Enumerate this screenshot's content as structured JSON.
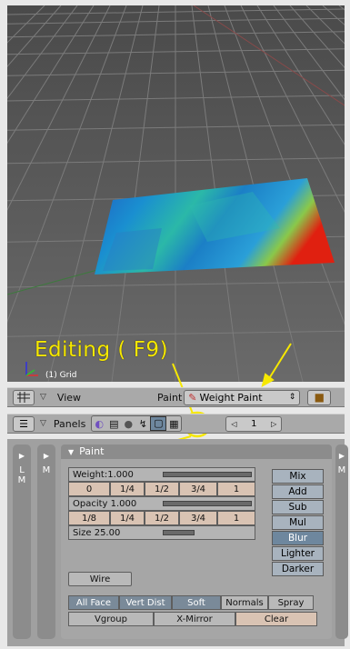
{
  "viewport": {
    "object_label": "(1) Grid",
    "callout": "Editing ( F9)"
  },
  "header1": {
    "view_menu": "View",
    "mode_prefix": "Paint",
    "mode_value": "Weight Paint"
  },
  "header2": {
    "panels_label": "Panels",
    "frame_value": "1"
  },
  "side_strips": {
    "left": "L\nM",
    "middle": "M",
    "right": "M"
  },
  "paint_panel": {
    "title": "Paint",
    "weight_label": "Weight:1.000",
    "weight_level": 1.0,
    "weight_presets": [
      "0",
      "1/4",
      "1/2",
      "3/4",
      "1"
    ],
    "opacity_label": "Opacity 1.000",
    "opacity_level": 1.0,
    "opacity_presets": [
      "1/8",
      "1/4",
      "1/2",
      "3/4",
      "1"
    ],
    "size_label": "Size 25.00",
    "size_level": 0.25,
    "blend_modes": [
      "Mix",
      "Add",
      "Sub",
      "Mul",
      "Blur",
      "Lighter",
      "Darker"
    ],
    "selected_blend": "Blur",
    "wire_label": "Wire",
    "toggles": [
      "All Face",
      "Vert Dist",
      "Soft",
      "Normals",
      "Spray"
    ],
    "bottom": [
      "Vgroup",
      "X-Mirror",
      "Clear"
    ]
  },
  "colors": {
    "callout": "#f6e800",
    "selected": "#6e879e",
    "number_button": "#d9c3b3"
  }
}
